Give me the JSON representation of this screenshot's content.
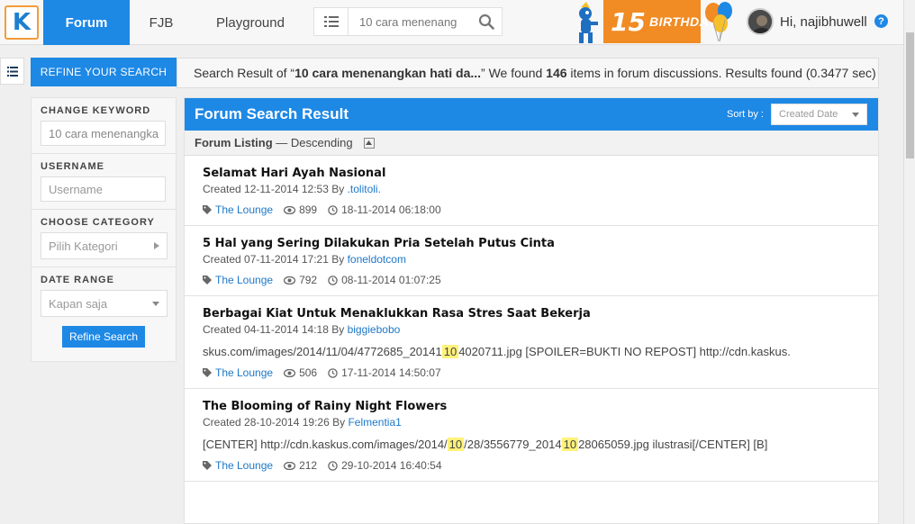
{
  "nav": {
    "logo": "K",
    "tabs": [
      {
        "label": "Forum",
        "active": true
      },
      {
        "label": "FJB",
        "active": false
      },
      {
        "label": "Playground",
        "active": false
      }
    ],
    "search_value": "10 cara menenang",
    "birthday_number": "15",
    "birthday_word": "BIRTHDAY",
    "greeting": "Hi, najibhuwell",
    "help": "?"
  },
  "refine": {
    "tab_label": "REFINE YOUR SEARCH",
    "result_prefix": "Search Result of “",
    "result_query": "10 cara menenangkan hati da...",
    "result_mid": "” We found ",
    "result_count": "146",
    "result_suffix": " items in forum discussions. Results found (0.3477 sec)"
  },
  "filters": {
    "keyword_label": "CHANGE KEYWORD",
    "keyword_value": "10 cara menenangka",
    "username_label": "USERNAME",
    "username_placeholder": "Username",
    "category_label": "CHOOSE CATEGORY",
    "category_value": "Pilih Kategori",
    "date_label": "DATE RANGE",
    "date_value": "Kapan saja",
    "refine_button": "Refine Search"
  },
  "main": {
    "title": "Forum Search Result",
    "sort_label": "Sort by :",
    "sort_value": "Created Date",
    "listing_label": "Forum Listing",
    "listing_order": " — Descending",
    "threads": [
      {
        "title": "Selamat Hari Ayah Nasional",
        "created": "Created 12-11-2014 12:53 By ",
        "author": ".tolitoli.",
        "category": "The Lounge",
        "views": "899",
        "last": "18-11-2014 06:18:00"
      },
      {
        "title": "5 Hal yang Sering Dilakukan Pria Setelah Putus Cinta",
        "created": "Created 07-11-2014 17:21 By ",
        "author": "foneldotcom",
        "category": "The Lounge",
        "views": "792",
        "last": "08-11-2014 01:07:25"
      },
      {
        "title": "Berbagai Kiat Untuk Menaklukkan Rasa Stres Saat Bekerja",
        "created": "Created 04-11-2014 14:18 By ",
        "author": "biggiebobo",
        "snippet_a": "skus.com/images/2014/11/04/4772685_20141",
        "snippet_hl": "10",
        "snippet_b": "4020711.jpg [SPOILER=BUKTI NO REPOST] http://cdn.kaskus.",
        "category": "The Lounge",
        "views": "506",
        "last": "17-11-2014 14:50:07"
      },
      {
        "title": "The Blooming of Rainy Night Flowers",
        "created": "Created 28-10-2014 19:26 By ",
        "author": "Felmentia1",
        "snippet_a": "[CENTER] http://cdn.kaskus.com/images/2014/",
        "snippet_hl": "10",
        "snippet_b": "/28/3556779_2014",
        "snippet_hl2": "10",
        "snippet_c": "28065059.jpg ilustrasi[/CENTER] [B]",
        "category": "The Lounge",
        "views": "212",
        "last": "29-10-2014 16:40:54"
      }
    ]
  },
  "colors": {
    "accent": "#1e88e5",
    "orange": "#f18b24",
    "highlight": "#fff27a"
  }
}
